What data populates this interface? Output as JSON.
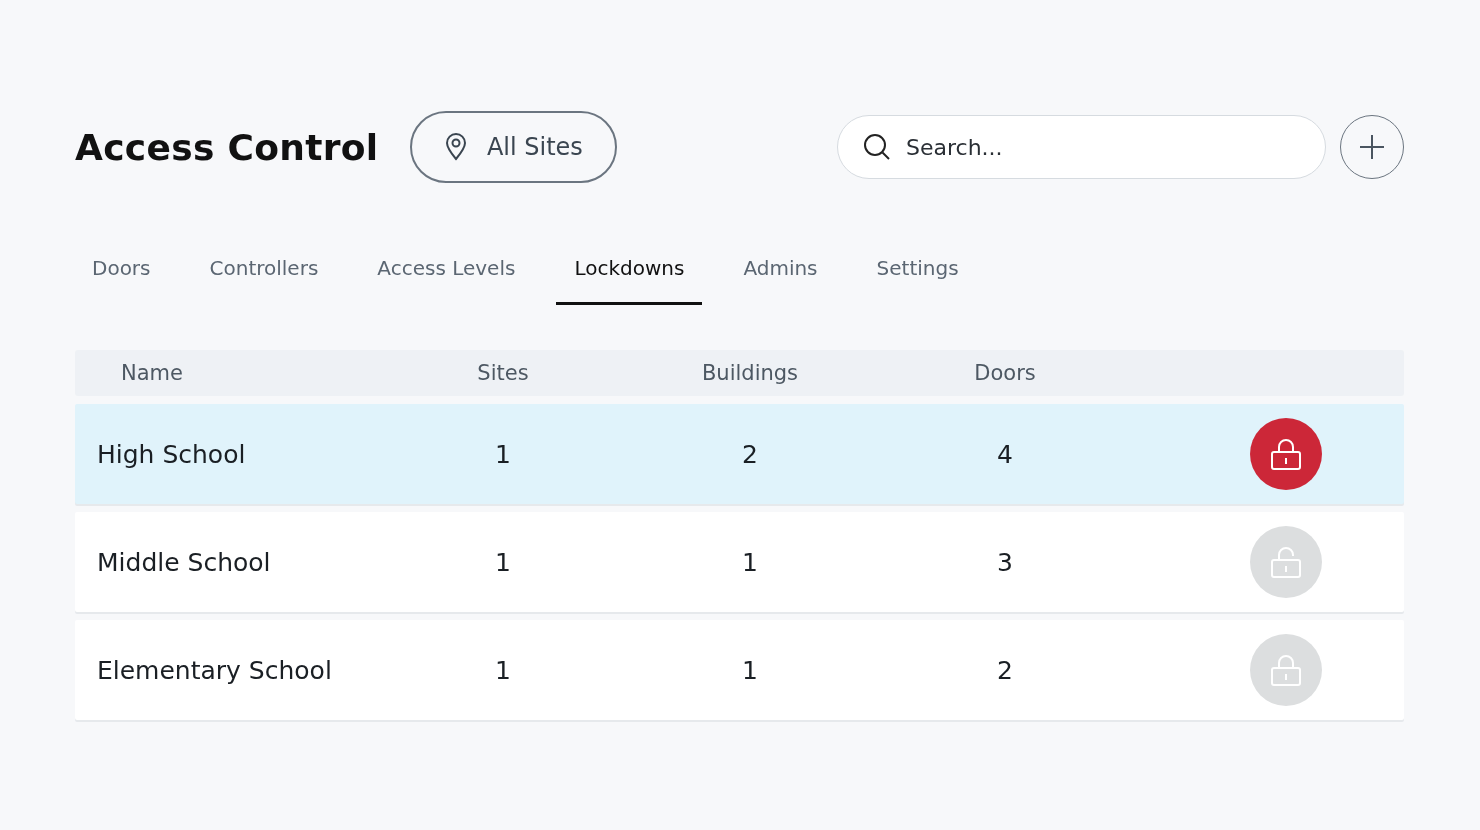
{
  "title": "Access Control",
  "site_filter": {
    "label": "All Sites"
  },
  "search": {
    "placeholder": "Search..."
  },
  "tabs": [
    {
      "label": "Doors",
      "selected": false
    },
    {
      "label": "Controllers",
      "selected": false
    },
    {
      "label": "Access Levels",
      "selected": false
    },
    {
      "label": "Lockdowns",
      "selected": true
    },
    {
      "label": "Admins",
      "selected": false
    },
    {
      "label": "Settings",
      "selected": false
    }
  ],
  "table": {
    "columns": [
      "Name",
      "Sites",
      "Buildings",
      "Doors"
    ],
    "rows": [
      {
        "name": "High School",
        "sites": "1",
        "buildings": "2",
        "doors": "4",
        "selected": true,
        "lock": {
          "active": true,
          "kind": "closed"
        }
      },
      {
        "name": "Middle School",
        "sites": "1",
        "buildings": "1",
        "doors": "3",
        "selected": false,
        "lock": {
          "active": false,
          "kind": "open"
        }
      },
      {
        "name": "Elementary School",
        "sites": "1",
        "buildings": "1",
        "doors": "2",
        "selected": false,
        "lock": {
          "active": false,
          "kind": "closed"
        }
      }
    ]
  }
}
